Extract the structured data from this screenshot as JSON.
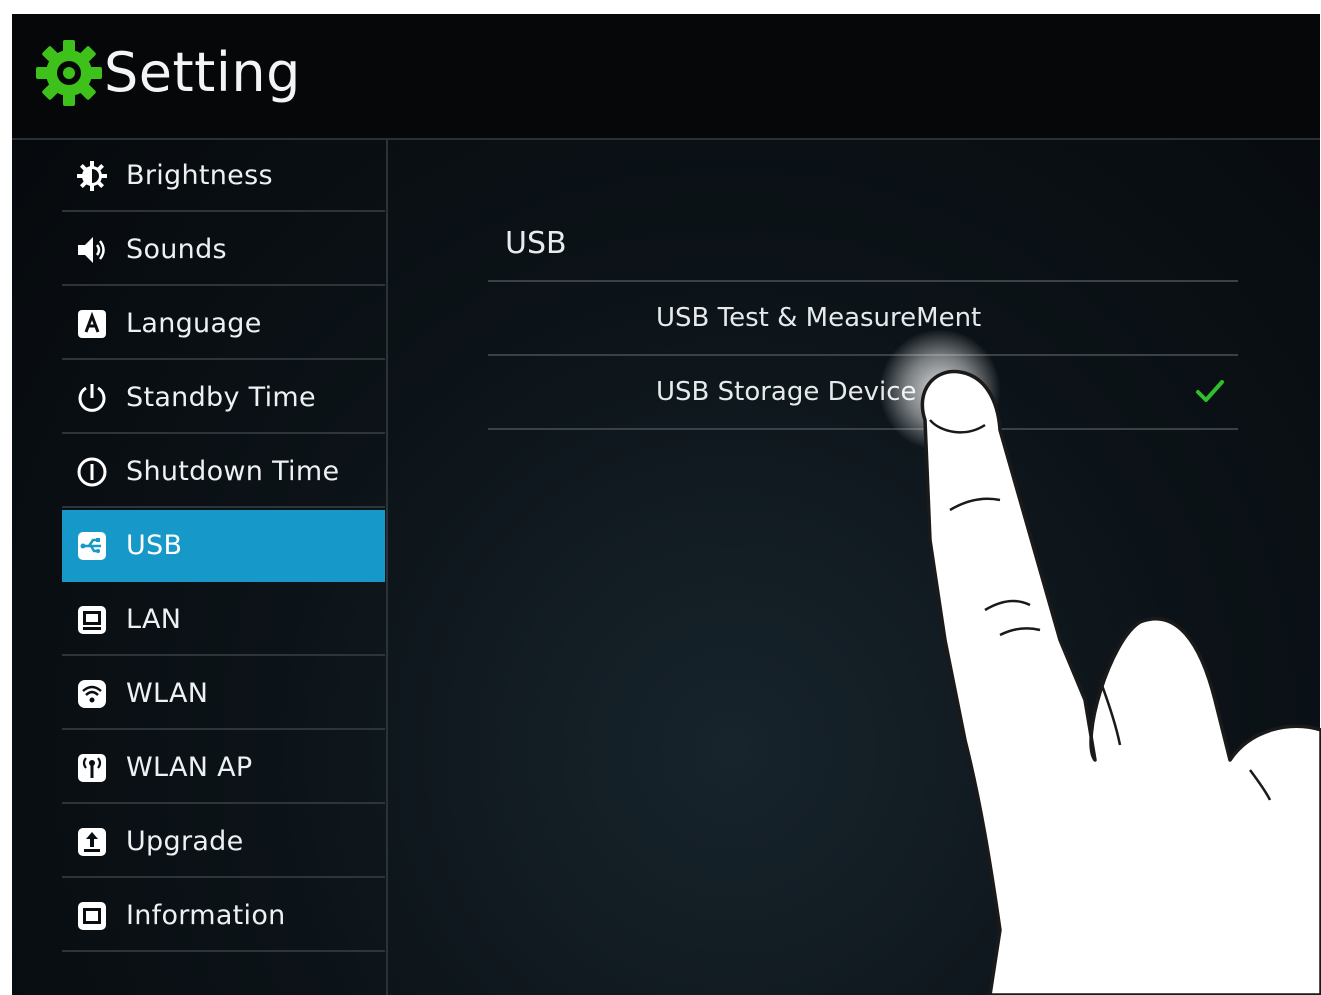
{
  "app": {
    "title": "Setting",
    "icon": "gear-icon",
    "accent_color": "#3ec21b"
  },
  "sidebar": {
    "selected_color": "#1698c9",
    "items": [
      {
        "label": "Brightness",
        "icon": "brightness-icon"
      },
      {
        "label": "Sounds",
        "icon": "speaker-icon"
      },
      {
        "label": "Language",
        "icon": "language-icon"
      },
      {
        "label": "Standby Time",
        "icon": "power-icon"
      },
      {
        "label": "Shutdown Time",
        "icon": "shutdown-icon"
      },
      {
        "label": "USB",
        "icon": "usb-icon",
        "selected": true
      },
      {
        "label": "LAN",
        "icon": "lan-icon"
      },
      {
        "label": "WLAN",
        "icon": "wifi-icon"
      },
      {
        "label": "WLAN AP",
        "icon": "hotspot-icon"
      },
      {
        "label": "Upgrade",
        "icon": "upgrade-icon"
      },
      {
        "label": "Information",
        "icon": "info-icon"
      }
    ]
  },
  "panel": {
    "title": "USB",
    "options": [
      {
        "label": "USB Test & MeasureMent",
        "selected": false
      },
      {
        "label": "USB Storage Device",
        "selected": true,
        "icon": "check-icon",
        "check_color": "#2fbf2a"
      }
    ]
  }
}
